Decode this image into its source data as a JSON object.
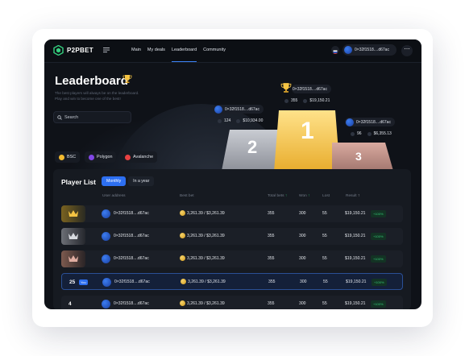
{
  "app": {
    "brand": "P2PBET"
  },
  "nav": {
    "items": [
      "Main",
      "My deals",
      "Leaderboard",
      "Community"
    ],
    "active_index": 2
  },
  "wallet": {
    "address": "0×32f1518....d67ac"
  },
  "header": {
    "title": "Leaderboard",
    "subtitle": "The best players will always be on the leaderboard. Play and win to become one of the best!"
  },
  "search": {
    "placeholder": "Search"
  },
  "chains": [
    {
      "label": "BSC",
      "color": "#f3ba2f"
    },
    {
      "label": "Polygon",
      "color": "#8247e5"
    },
    {
      "label": "Avalanche",
      "color": "#e84142"
    }
  ],
  "podium": {
    "first": {
      "rank": "1",
      "address": "0×32f1518....d67ac",
      "count": "355",
      "amount": "$19,150.21"
    },
    "second": {
      "rank": "2",
      "address": "0×32f1518....d67ac",
      "count": "124",
      "amount": "$10,934.00"
    },
    "third": {
      "rank": "3",
      "address": "0×32f1518....d67ac",
      "count": "96",
      "amount": "$6,355.13"
    }
  },
  "player_list": {
    "title": "Player List",
    "tabs": [
      "Monthly",
      "In a year"
    ],
    "active_tab": 0,
    "columns": [
      "User address",
      "Best bet",
      "Total bets",
      "Won",
      "Lost",
      "Result"
    ],
    "rows": [
      {
        "rank": "",
        "medal": "gold",
        "address": "0×32f1518....d67ac",
        "best_bet": "3,261.39 / $3,261.39",
        "total": "355",
        "won": "300",
        "lost": "55",
        "result": "$19,150.21",
        "badge": "+100%"
      },
      {
        "rank": "",
        "medal": "silver",
        "address": "0×32f1518....d67ac",
        "best_bet": "3,261.39 / $3,261.39",
        "total": "355",
        "won": "300",
        "lost": "55",
        "result": "$19,150.21",
        "badge": "+100%"
      },
      {
        "rank": "",
        "medal": "bronze",
        "address": "0×32f1518....d67ac",
        "best_bet": "3,261.39 / $3,261.39",
        "total": "355",
        "won": "300",
        "lost": "55",
        "result": "$19,150.21",
        "badge": "+100%"
      },
      {
        "rank": "25",
        "you": "You",
        "address": "0×32f1518....d67ac",
        "best_bet": "3,261.39 / $3,261.39",
        "total": "355",
        "won": "300",
        "lost": "55",
        "result": "$19,150.21",
        "badge": "+100%"
      },
      {
        "rank": "4",
        "address": "0×32f1518....d67ac",
        "best_bet": "3,261.39 / $3,261.39",
        "total": "355",
        "won": "300",
        "lost": "55",
        "result": "$19,150.21",
        "badge": "+100%"
      }
    ]
  },
  "colors": {
    "accent": "#2d6ff1",
    "gold": "#f5c443",
    "positive": "#34c474"
  }
}
